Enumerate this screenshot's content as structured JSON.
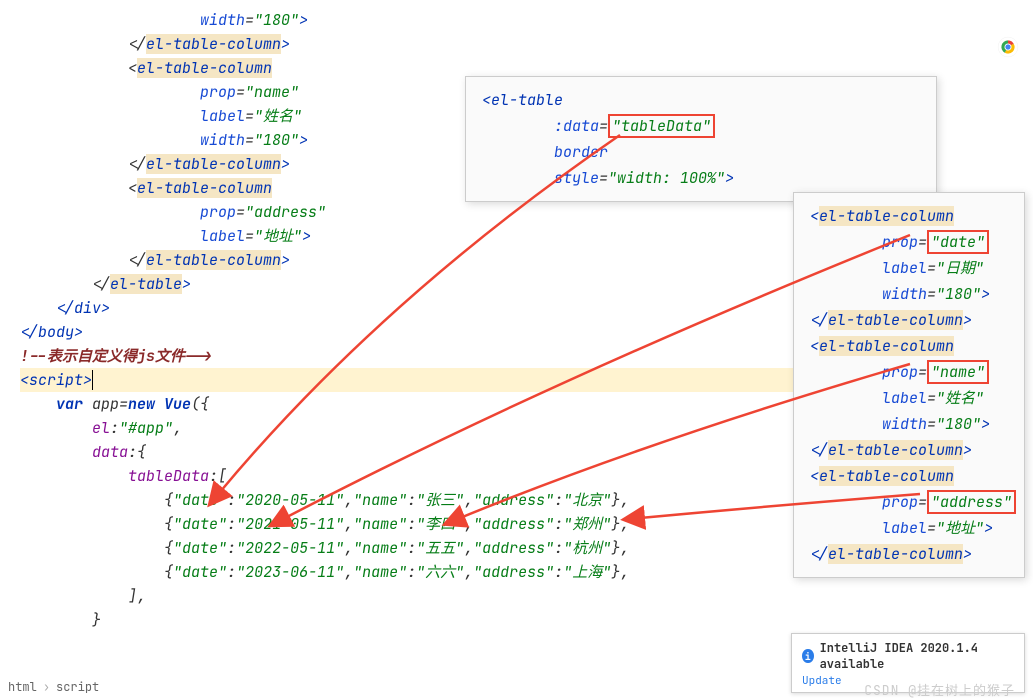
{
  "breadcrumb": {
    "item1": "html",
    "item2": "script"
  },
  "main_code": {
    "l0": "                    width=\"180\">",
    "l1a": "            </",
    "l1b": "el-table-column",
    "l1c": ">",
    "l2a": "            <",
    "l2b": "el-table-column",
    "l3a": "                    ",
    "l3attr": "prop",
    "l3eq": "=",
    "l3v": "\"name\"",
    "l4a": "                    ",
    "l4attr": "label",
    "l4eq": "=",
    "l4v": "\"姓名\"",
    "l5a": "                    ",
    "l5attr": "width",
    "l5eq": "=",
    "l5v": "\"180\"",
    "l5end": ">",
    "l6a": "            </",
    "l6b": "el-table-column",
    "l6c": ">",
    "l7a": "            <",
    "l7b": "el-table-column",
    "l8a": "                    ",
    "l8attr": "prop",
    "l8eq": "=",
    "l8v": "\"address\"",
    "l9a": "                    ",
    "l9attr": "label",
    "l9eq": "=",
    "l9v": "\"地址\"",
    "l9end": ">",
    "l10a": "            </",
    "l10b": "el-table-column",
    "l10c": ">",
    "l11a": "        </",
    "l11b": "el-table",
    "l11c": ">",
    "l12": "    </div>",
    "l13a": "</",
    "l13b": "body",
    "l13c": ">",
    "comment": "!--表示自定义得js文件-->",
    "scrpt_open": "script",
    "var": "var",
    "app": " app=",
    "newV": "new Vue",
    "paren": "({",
    "el_k": "el",
    "el_v": "\"#app\"",
    "data_k": "data",
    "td_k": "tableData",
    "td_open": ":[",
    "row1": "{\"date\":\"2020-05-11\",\"name\":\"张三\",\"address\":\"北京\"},",
    "row2": "{\"date\":\"2021-05-11\",\"name\":\"李四\",\"address\":\"郑州\"},",
    "row3": "{\"date\":\"2022-05-11\",\"name\":\"五五\",\"address\":\"杭州\"},",
    "row4": "{\"date\":\"2023-06-11\",\"name\":\"六六\",\"address\":\"上海\"},",
    "arr_close": "],",
    "brace_close": "}"
  },
  "popup_center": {
    "l1": "<el-table",
    "l2a": "        :data",
    "l2eq": "=",
    "l2v": "\"tableData\"",
    "l3": "        border",
    "l4a": "        style",
    "l4eq": "=",
    "l4v": "\"width: 100%\"",
    "l4end": ">"
  },
  "popup_right": {
    "c1a": "<",
    "c1b": "el-table-column",
    "p1a": "        prop",
    "p1eq": "=",
    "p1v": "\"date\"",
    "lb1a": "        label",
    "lb1eq": "=",
    "lb1v": "\"日期\"",
    "w1a": "        width",
    "w1eq": "=",
    "w1v": "\"180\"",
    "w1end": ">",
    "ce1a": "</",
    "ce1b": "el-table-column",
    "ce1c": ">",
    "c2a": "<",
    "c2b": "el-table-column",
    "p2a": "        prop",
    "p2eq": "=",
    "p2v": "\"name\"",
    "lb2a": "        label",
    "lb2eq": "=",
    "lb2v": "\"姓名\"",
    "w2a": "        width",
    "w2eq": "=",
    "w2v": "\"180\"",
    "w2end": ">",
    "ce2a": "</",
    "ce2b": "el-table-column",
    "ce2c": ">",
    "c3a": "<",
    "c3b": "el-table-column",
    "p3a": "        prop",
    "p3eq": "=",
    "p3v": "\"address\"",
    "lb3a": "        label",
    "lb3eq": "=",
    "lb3v": "\"地址\"",
    "lb3end": ">",
    "ce3a": "</",
    "ce3b": "el-table-column",
    "ce3c": ">"
  },
  "notif": {
    "title": "IntelliJ IDEA 2020.1.4 available",
    "action": "Update"
  },
  "watermark": "CSDN @挂在树上的猴子"
}
